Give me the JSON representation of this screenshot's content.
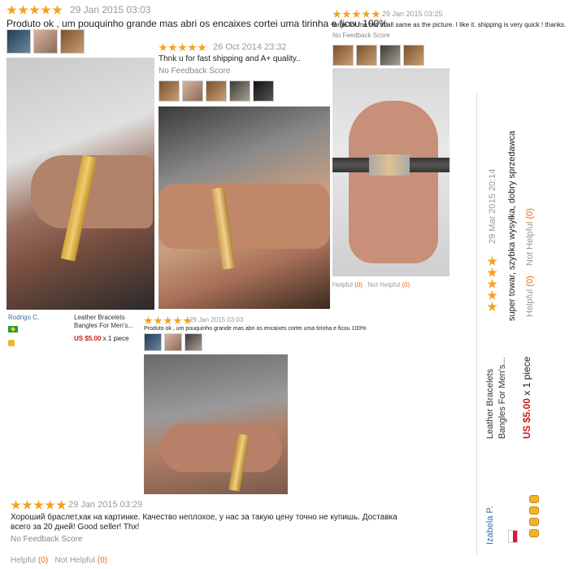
{
  "review1": {
    "date": "29 Jan 2015 03:03",
    "text": "Produto ok , um pouquinho grande mas abri os encaixes cortei uma tirinha e ficou 100%"
  },
  "review2": {
    "date": "26 Oct 2014 23:32",
    "text": "Thnk u for fast shipping and A+ quality..",
    "feedback": "No Feedback Score"
  },
  "review3": {
    "date": "29 Jan 2015 03:25",
    "text": "large for me but at all same as the picture. I like it. shipping is very quick ! thanks.",
    "feedback": "No Feedback Score",
    "helpful_label": "Helpful",
    "helpful_count": "(0)",
    "not_helpful_label": "Not Helpful",
    "not_helpful_count": "(0)"
  },
  "reviewer1": {
    "name": "Rodrigo C.",
    "product": "Leather Bracelets Bangles For Men's...",
    "price": "US $5.00",
    "qty": "x 1 piece"
  },
  "review4": {
    "date": "29 Jan 2015 03:03",
    "text": "Produto ok , um pouquinho grande mas abri os encaixes cortei uma tirinha e ficou 100%"
  },
  "review5": {
    "date": "29 Jan 2015 03:29",
    "text": "Хороший браслет,как на картинке. Качество неплохое, у нас за такую цену точно не купишь. Доставка всего за 20 дней! Good seller! Thx!",
    "feedback": "No Feedback Score",
    "helpful_label": "Helpful",
    "helpful_count": "(0)",
    "not_helpful_label": "Not Helpful",
    "not_helpful_count": "(0)"
  },
  "review6": {
    "date": "29 Mar 2015 20:14",
    "text": "super towar, szybka wysyłka, dobry sprzedawca",
    "helpful_label": "Helpful",
    "helpful_count": "(0)",
    "not_helpful_label": "Not Helpful",
    "not_helpful_count": "(0)",
    "product_line1": "Leather Bracelets",
    "product_line2": "Bangles For Men's...",
    "price": "US $5.00",
    "qty": "x 1 piece",
    "reviewer": "Izabela P."
  },
  "colors": {
    "star": "#f5a11c",
    "price": "#cc1b1b",
    "helpful_count": "#e8641e",
    "link": "#3a6ea5"
  }
}
